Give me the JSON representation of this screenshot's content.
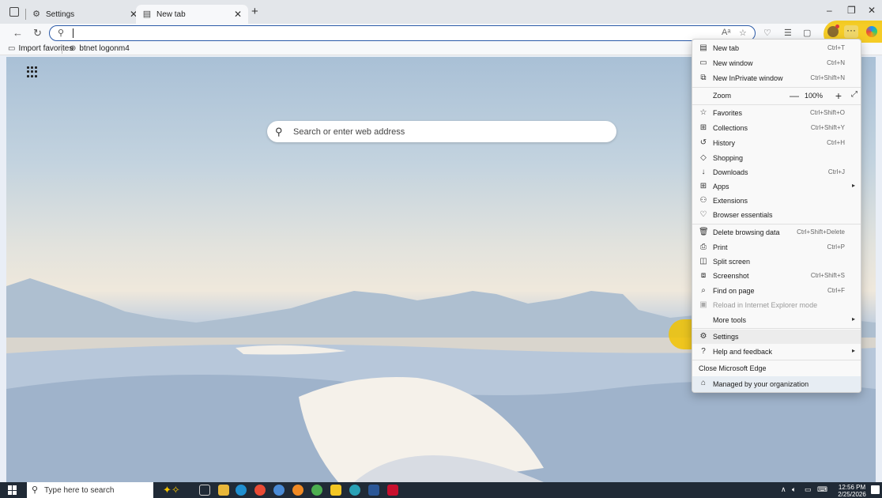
{
  "tabs": [
    {
      "title": "Settings",
      "icon": "gear-icon"
    },
    {
      "title": "New tab",
      "icon": "newtab-icon"
    }
  ],
  "address": {
    "value": "",
    "placeholder": ""
  },
  "favorites": [
    {
      "label": "Import favorites",
      "icon": "folder-icon"
    },
    {
      "label": "btnet logonm4",
      "icon": "globe-icon"
    }
  ],
  "search": {
    "placeholder": "Search or enter web address"
  },
  "menu": {
    "new_tab": {
      "label": "New tab",
      "shortcut": "Ctrl+T"
    },
    "new_window": {
      "label": "New window",
      "shortcut": "Ctrl+N"
    },
    "new_inprivate": {
      "label": "New InPrivate window",
      "shortcut": "Ctrl+Shift+N"
    },
    "zoom": {
      "label": "Zoom",
      "value": "100%"
    },
    "favorites": {
      "label": "Favorites",
      "shortcut": "Ctrl+Shift+O"
    },
    "collections": {
      "label": "Collections",
      "shortcut": "Ctrl+Shift+Y"
    },
    "history": {
      "label": "History",
      "shortcut": "Ctrl+H"
    },
    "shopping": {
      "label": "Shopping"
    },
    "downloads": {
      "label": "Downloads",
      "shortcut": "Ctrl+J"
    },
    "apps": {
      "label": "Apps"
    },
    "extensions": {
      "label": "Extensions"
    },
    "browser_essentials": {
      "label": "Browser essentials"
    },
    "delete_browsing_data": {
      "label": "Delete browsing data",
      "shortcut": "Ctrl+Shift+Delete"
    },
    "print": {
      "label": "Print",
      "shortcut": "Ctrl+P"
    },
    "split_screen": {
      "label": "Split screen"
    },
    "screenshot": {
      "label": "Screenshot",
      "shortcut": "Ctrl+Shift+S"
    },
    "find_on_page": {
      "label": "Find on page",
      "shortcut": "Ctrl+F"
    },
    "reload_ie": {
      "label": "Reload in Internet Explorer mode"
    },
    "more_tools": {
      "label": "More tools"
    },
    "settings": {
      "label": "Settings"
    },
    "help": {
      "label": "Help and feedback"
    },
    "close_edge": {
      "label": "Close Microsoft Edge"
    },
    "managed": {
      "label": "Managed by your organization"
    }
  },
  "taskbar": {
    "search_placeholder": "Type here to search",
    "time": "12:56 PM",
    "date": "2/25/2026"
  },
  "colors": {
    "highlight": "#f5c400",
    "accent": "#2b5aa8",
    "taskbar": "#202a36"
  }
}
